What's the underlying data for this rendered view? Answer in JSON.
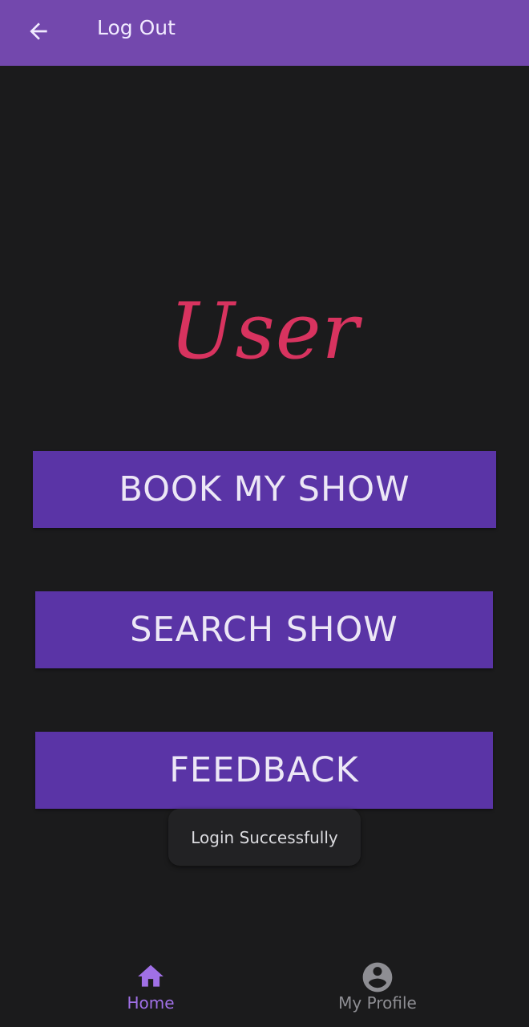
{
  "app_bar": {
    "title": "Log Out",
    "back_icon": "arrow-left-icon",
    "background": "#7348ad"
  },
  "hero": {
    "title": "User",
    "color": "#d8335f"
  },
  "actions": [
    {
      "label": "BOOK MY SHOW"
    },
    {
      "label": "SEARCH SHOW"
    },
    {
      "label": "FEEDBACK"
    }
  ],
  "toast": {
    "message": "Login Successfully"
  },
  "bottom_nav": {
    "items": [
      {
        "label": "Home",
        "icon": "home-icon",
        "active": true,
        "color": "#a070e6"
      },
      {
        "label": "My Profile",
        "icon": "account-circle-icon",
        "active": false,
        "color": "#8e8e93"
      }
    ]
  },
  "colors": {
    "background": "#1b1b1c",
    "button": "#5a34a6",
    "button_text": "#ece7f6"
  }
}
